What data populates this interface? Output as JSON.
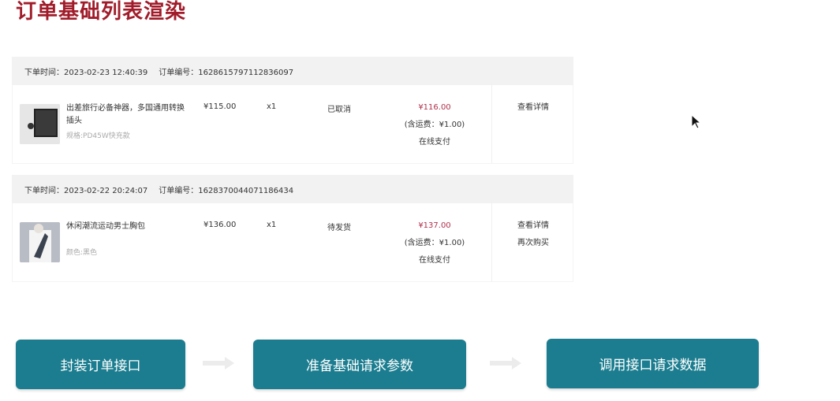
{
  "title": "订单基础列表渲染",
  "orders": [
    {
      "time_label": "下单时间：",
      "time": "2023-02-23 12:40:39",
      "no_label": "订单编号：",
      "no": "1628615797112836097",
      "product": "出差旅行必备神器，多国通用转换插头",
      "spec": "规格:PD45W快充款",
      "price": "¥115.00",
      "qty": "x1",
      "status": "已取消",
      "total": "¥116.00",
      "freight": "(含运费：¥1.00)",
      "pay": "在线支付",
      "actions": [
        "查看详情"
      ]
    },
    {
      "time_label": "下单时间：",
      "time": "2023-02-22 20:24:07",
      "no_label": "订单编号：",
      "no": "1628370044071186434",
      "product": "休闲潮流运动男士胸包",
      "spec": "颜色:黑色",
      "price": "¥136.00",
      "qty": "x1",
      "status": "待发货",
      "total": "¥137.00",
      "freight": "(含运费：¥1.00)",
      "pay": "在线支付",
      "actions": [
        "查看详情",
        "再次购买"
      ]
    }
  ],
  "steps": [
    "封装订单接口",
    "准备基础请求参数",
    "调用接口请求数据"
  ],
  "colors": {
    "title": "#a01c2a",
    "step": "#1b7d8f",
    "amount": "#b0304a"
  }
}
